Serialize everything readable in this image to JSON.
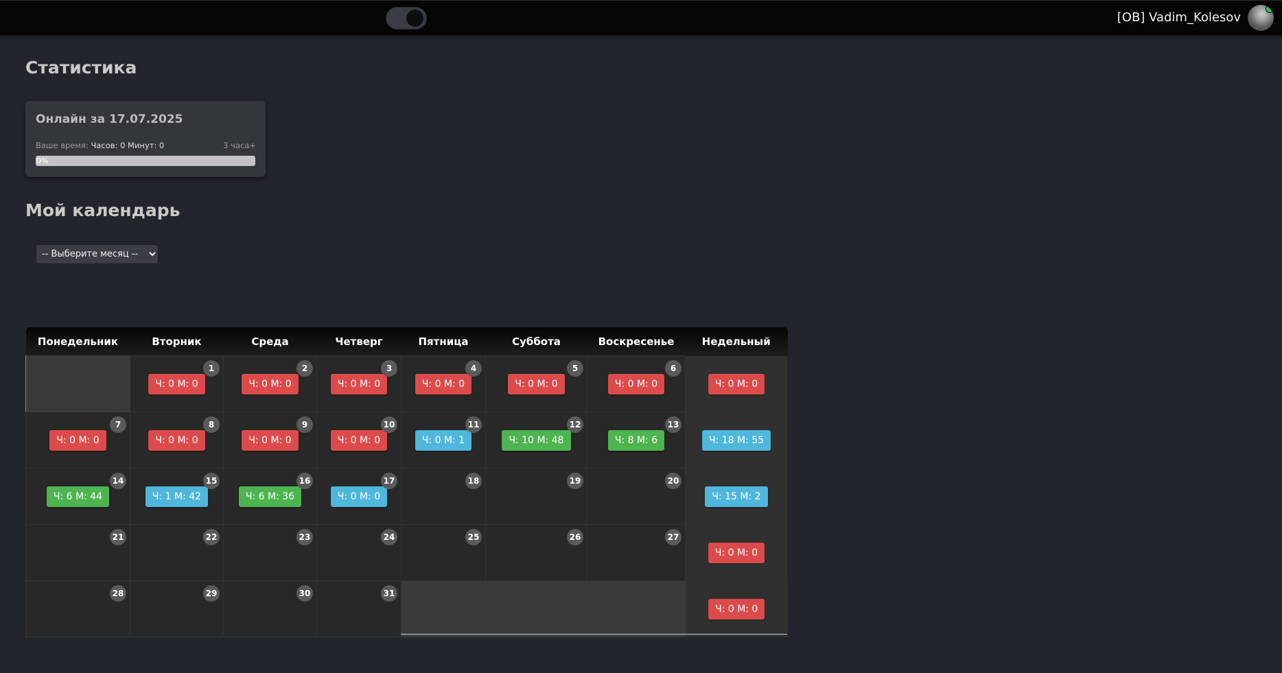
{
  "header": {
    "user_name": "[OB] Vadim_Kolesov",
    "theme_toggle_state": "dark"
  },
  "stats": {
    "heading": "Статистика",
    "card_title": "Онлайн за 17.07.2025",
    "time_label": "Ваше время:",
    "time_value": "Часов: 0 Минут: 0",
    "goal_label": "3 часа+",
    "progress_percent": 0,
    "progress_text": "0%"
  },
  "calendar": {
    "heading": "Мой календарь",
    "month_select_value": "-- Выберите месяц --",
    "headers": [
      "Понедельник",
      "Вторник",
      "Среда",
      "Четверг",
      "Пятница",
      "Суббота",
      "Воскресенье",
      "Недельный"
    ],
    "weeks": [
      {
        "days": [
          null,
          {
            "n": "1",
            "text": "Ч: 0 М: 0",
            "color": "red"
          },
          {
            "n": "2",
            "text": "Ч: 0 М: 0",
            "color": "red"
          },
          {
            "n": "3",
            "text": "Ч: 0 М: 0",
            "color": "red"
          },
          {
            "n": "4",
            "text": "Ч: 0 М: 0",
            "color": "red"
          },
          {
            "n": "5",
            "text": "Ч: 0 М: 0",
            "color": "red"
          },
          {
            "n": "6",
            "text": "Ч: 0 М: 0",
            "color": "red"
          }
        ],
        "weekly": {
          "text": "Ч: 0 М: 0",
          "color": "red"
        }
      },
      {
        "days": [
          {
            "n": "7",
            "text": "Ч: 0 М: 0",
            "color": "red"
          },
          {
            "n": "8",
            "text": "Ч: 0 М: 0",
            "color": "red"
          },
          {
            "n": "9",
            "text": "Ч: 0 М: 0",
            "color": "red"
          },
          {
            "n": "10",
            "text": "Ч: 0 М: 0",
            "color": "red"
          },
          {
            "n": "11",
            "text": "Ч: 0 М: 1",
            "color": "blue"
          },
          {
            "n": "12",
            "text": "Ч: 10 М: 48",
            "color": "green"
          },
          {
            "n": "13",
            "text": "Ч: 8 М: 6",
            "color": "green"
          }
        ],
        "weekly": {
          "text": "Ч: 18 М: 55",
          "color": "blue"
        }
      },
      {
        "days": [
          {
            "n": "14",
            "text": "Ч: 6 М: 44",
            "color": "green"
          },
          {
            "n": "15",
            "text": "Ч: 1 М: 42",
            "color": "blue"
          },
          {
            "n": "16",
            "text": "Ч: 6 М: 36",
            "color": "green"
          },
          {
            "n": "17",
            "text": "Ч: 0 М: 0",
            "color": "blue"
          },
          {
            "n": "18"
          },
          {
            "n": "19"
          },
          {
            "n": "20"
          }
        ],
        "weekly": {
          "text": "Ч: 15 М: 2",
          "color": "blue"
        }
      },
      {
        "days": [
          {
            "n": "21"
          },
          {
            "n": "22"
          },
          {
            "n": "23"
          },
          {
            "n": "24"
          },
          {
            "n": "25"
          },
          {
            "n": "26"
          },
          {
            "n": "27"
          }
        ],
        "weekly": {
          "text": "Ч: 0 М: 0",
          "color": "red"
        }
      },
      {
        "days": [
          {
            "n": "28"
          },
          {
            "n": "29"
          },
          {
            "n": "30"
          },
          {
            "n": "31"
          },
          null,
          null,
          null
        ],
        "weekly": {
          "text": "Ч: 0 М: 0",
          "color": "red"
        }
      }
    ]
  }
}
